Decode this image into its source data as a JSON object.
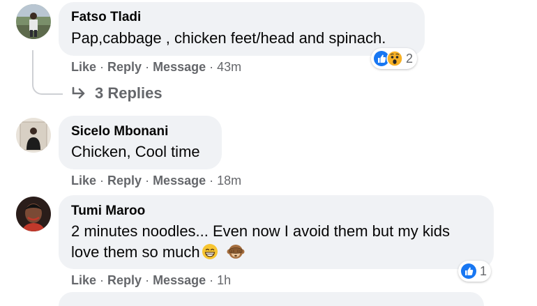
{
  "colors": {
    "bubble": "#f0f2f5",
    "meta": "#65676b",
    "like_blue": "#1877f2",
    "haha_yellow": "#f7b125"
  },
  "comments": [
    {
      "author": "Fatso Tladi",
      "text": "Pap,cabbage , chicken feet/head and spinach.",
      "actions": {
        "like": "Like",
        "reply": "Reply",
        "message": "Message",
        "time": "43m"
      },
      "reactions": {
        "icons": [
          "like-icon",
          "wow-icon"
        ],
        "count": "2"
      }
    },
    {
      "author": "Sicelo Mbonani",
      "text": "Chicken, Cool time",
      "actions": {
        "like": "Like",
        "reply": "Reply",
        "message": "Message",
        "time": "18m"
      }
    },
    {
      "author": "Tumi Maroo",
      "text_line1": "2 minutes noodles... Even now I avoid them but my kids",
      "text_line2": "love them so much",
      "emojis": [
        "grin-emoji",
        "see-no-evil-monkey-emoji"
      ],
      "actions": {
        "like": "Like",
        "reply": "Reply",
        "message": "Message",
        "time": "1h"
      },
      "reactions": {
        "icons": [
          "like-icon"
        ],
        "count": "1"
      }
    }
  ],
  "thread": {
    "replies_label": "3 Replies"
  },
  "separator": "·"
}
